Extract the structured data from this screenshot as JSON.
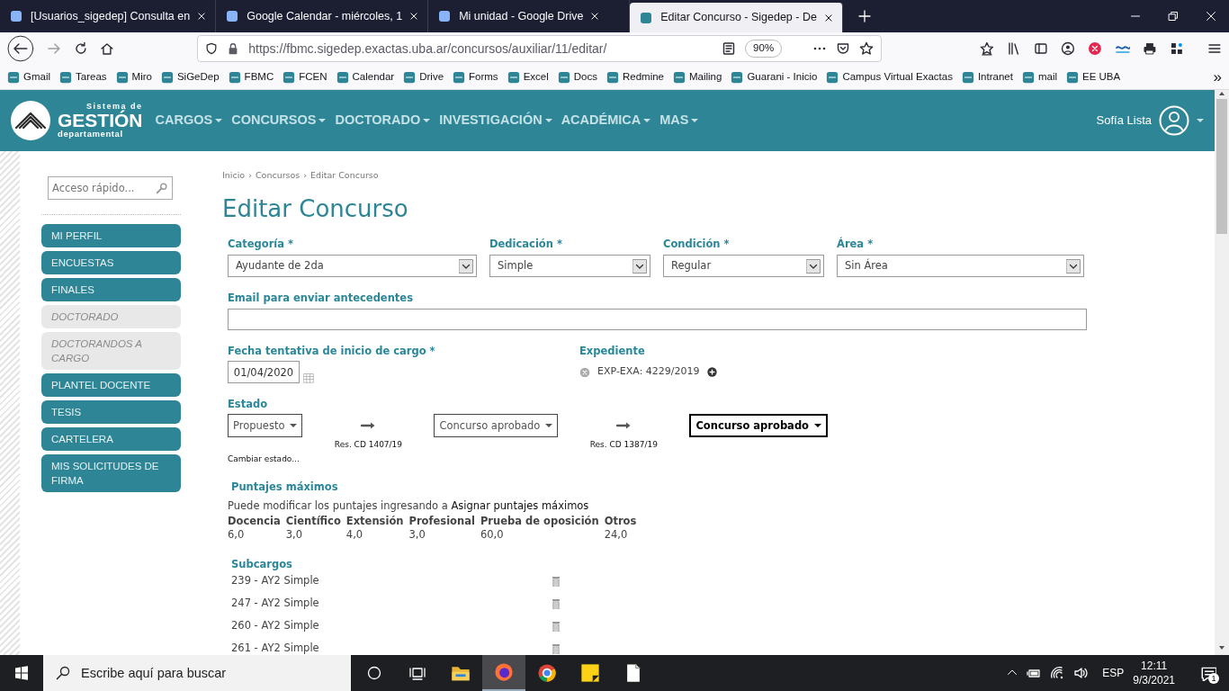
{
  "browser": {
    "tabs": [
      {
        "title": "[Usuarios_sigedep] Consulta en",
        "selected": false
      },
      {
        "title": "Google Calendar - miércoles, 1",
        "selected": false
      },
      {
        "title": "Mi unidad - Google Drive",
        "selected": false
      },
      {
        "title": "Editar Concurso - Sigedep - De",
        "selected": true
      }
    ],
    "url": "https://fbmc.sigedep.exactas.uba.ar/concursos/auxiliar/11/editar/",
    "zoom": "90%",
    "bookmarks": [
      "Gmail",
      "Tareas",
      "Miro",
      "SiGeDep",
      "FBMC",
      "FCEN",
      "Calendar",
      "Drive",
      "Forms",
      "Excel",
      "Docs",
      "Redmine",
      "Mailing",
      "Guarani - Inicio",
      "Campus Virtual Exactas",
      "Intranet",
      "mail",
      "EE UBA"
    ],
    "bookmarks_overflow": "»"
  },
  "app": {
    "logo": {
      "line1": "Sistema de",
      "line2": "GESTIÓN",
      "line3": "departamental"
    },
    "menu": [
      "CARGOS",
      "CONCURSOS",
      "DOCTORADO",
      "INVESTIGACIÓN",
      "ACADÉMICA",
      "MAS"
    ],
    "user": "Sofía Lista"
  },
  "sidebar": {
    "search_placeholder": "Acceso rápido...",
    "items": [
      {
        "label": "MI PERFIL",
        "disabled": false
      },
      {
        "label": "ENCUESTAS",
        "disabled": false
      },
      {
        "label": "FINALES",
        "disabled": false
      },
      {
        "label": "DOCTORADO",
        "disabled": true
      },
      {
        "label": "DOCTORANDOS A CARGO",
        "disabled": true
      },
      {
        "label": "PLANTEL DOCENTE",
        "disabled": false
      },
      {
        "label": "TESIS",
        "disabled": false
      },
      {
        "label": "CARTELERA",
        "disabled": false
      },
      {
        "label": "MIS SOLICITUDES DE FIRMA",
        "disabled": false
      }
    ]
  },
  "breadcrumbs": [
    {
      "label": "Inicio",
      "separator": "›"
    },
    {
      "label": "Concursos",
      "separator": "›"
    },
    {
      "label": "Editar Concurso"
    }
  ],
  "title": "Editar Concurso",
  "fields": [
    {
      "label": "Categoría *",
      "value": "Ayudante de 2da"
    },
    {
      "label": "Dedicación *",
      "value": "Simple"
    },
    {
      "label": "Condición *",
      "value": "Regular"
    },
    {
      "label": "Área *",
      "value": "Sin Área"
    }
  ],
  "email": {
    "label": "Email para enviar antecedentes"
  },
  "start_date": {
    "label": "Fecha tentativa de inicio de cargo *",
    "value": "01/04/2020"
  },
  "expediente": {
    "label": "Expediente",
    "value": "EXP-EXA: 4229/2019"
  },
  "estado": {
    "label": "Estado",
    "steps": [
      {
        "label": "Propuesto",
        "current": false
      },
      {
        "label": "Concurso aprobado",
        "current": false,
        "resolution": "Res. CD 1407/19"
      },
      {
        "label": "Concurso aprobado",
        "current": true,
        "resolution": "Res. CD 1387/19"
      }
    ],
    "change_link": "Cambiar estado..."
  },
  "puntajes": {
    "label": "Puntajes máximos",
    "note": "Puede modificar los puntajes ingresando a",
    "link": "Asignar puntajes máximos",
    "columns": [
      {
        "header": "Docencia",
        "value": "6,0"
      },
      {
        "header": "Científico",
        "value": "3,0"
      },
      {
        "header": "Extensión",
        "value": "4,0"
      },
      {
        "header": "Profesional",
        "value": "3,0"
      },
      {
        "header": "Prueba de oposición",
        "value": "60,0"
      },
      {
        "header": "Otros",
        "value": "24,0"
      }
    ]
  },
  "subcargos": {
    "label": "Subcargos",
    "items": [
      "239 - AY2 Simple",
      "247 - AY2 Simple",
      "260 - AY2 Simple",
      "261 - AY2 Simple"
    ]
  },
  "taskbar": {
    "search_placeholder": "Escribe aquí para buscar",
    "apps": [
      {
        "kind": "folder",
        "selected": false
      },
      {
        "kind": "firefox",
        "selected": true
      },
      {
        "kind": "chrome",
        "selected": false
      },
      {
        "kind": "notes",
        "selected": false
      },
      {
        "kind": "file",
        "selected": false
      }
    ],
    "lang": "ESP",
    "time": "12:11",
    "date": "9/3/2021",
    "notifications": "1"
  }
}
